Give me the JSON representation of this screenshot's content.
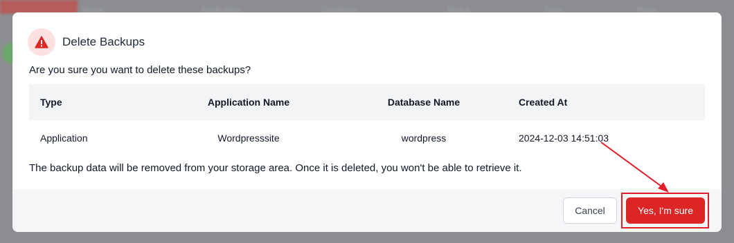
{
  "background": {
    "columns": [
      "Name",
      "Application",
      "Database",
      "Status",
      "Type",
      "Price"
    ]
  },
  "modal": {
    "title": "Delete Backups",
    "question": "Are you sure you want to delete these backups?",
    "table": {
      "headers": [
        "Type",
        "Application Name",
        "Database Name",
        "Created At"
      ],
      "rows": [
        [
          "Application",
          "Wordpresssite",
          "wordpress",
          "2024-12-03 14:51:03"
        ]
      ]
    },
    "note": "The backup data will be removed from your storage area. Once it is deleted, you won't be able to retrieve it.",
    "cancel_label": "Cancel",
    "confirm_label": "Yes, I'm sure"
  },
  "colors": {
    "danger": "#dc2626",
    "danger_soft": "#fde1e1",
    "annotation": "#e11d2a"
  },
  "icons": {
    "warning": "warning-triangle-icon"
  }
}
